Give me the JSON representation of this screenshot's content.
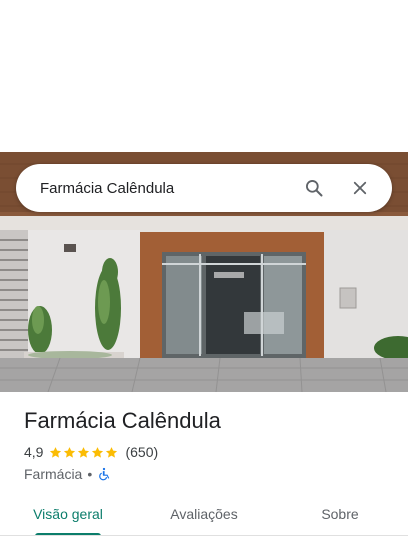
{
  "search": {
    "query": "Farmácia Calêndula",
    "search_icon": "search-icon",
    "clear_icon": "close-icon"
  },
  "hero": {
    "description_icon": "storefront-photo"
  },
  "place": {
    "title": "Farmácia Calêndula",
    "rating": "4,9",
    "stars": 5,
    "review_count": "(650)",
    "category": "Farmácia",
    "separator": "•",
    "accessibility_icon": "wheelchair-icon"
  },
  "tabs": [
    {
      "label": "Visão geral",
      "active": true
    },
    {
      "label": "Avaliações",
      "active": false
    },
    {
      "label": "Sobre",
      "active": false
    }
  ],
  "colors": {
    "accent": "#0b7d6b",
    "star": "#fbbc04",
    "accessibility": "#1a73e8"
  }
}
